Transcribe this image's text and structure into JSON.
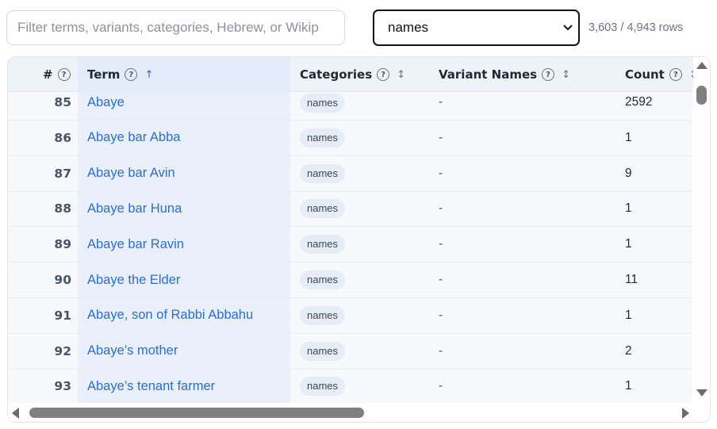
{
  "search": {
    "placeholder": "Filter terms, variants, categories, Hebrew, or Wikip",
    "value": ""
  },
  "category_filter": {
    "selected": "names"
  },
  "row_count": "3,603 / 4,943 rows",
  "columns": {
    "index": "#",
    "term": "Term",
    "categories": "Categories",
    "variant_names": "Variant Names",
    "count": "Count",
    "help_glyph": "?",
    "term_sort": "↑",
    "unsorted_glyph": "↕"
  },
  "rows": [
    {
      "index": "85",
      "term": "Abaye",
      "category": "names",
      "variant": "-",
      "count": "2592"
    },
    {
      "index": "86",
      "term": "Abaye bar Abba",
      "category": "names",
      "variant": "-",
      "count": "1"
    },
    {
      "index": "87",
      "term": "Abaye bar Avin",
      "category": "names",
      "variant": "-",
      "count": "9"
    },
    {
      "index": "88",
      "term": "Abaye bar Huna",
      "category": "names",
      "variant": "-",
      "count": "1"
    },
    {
      "index": "89",
      "term": "Abaye bar Ravin",
      "category": "names",
      "variant": "-",
      "count": "1"
    },
    {
      "index": "90",
      "term": "Abaye the Elder",
      "category": "names",
      "variant": "-",
      "count": "11"
    },
    {
      "index": "91",
      "term": "Abaye, son of Rabbi Abbahu",
      "category": "names",
      "variant": "-",
      "count": "1"
    },
    {
      "index": "92",
      "term": "Abaye’s mother",
      "category": "names",
      "variant": "-",
      "count": "2"
    },
    {
      "index": "93",
      "term": "Abaye’s tenant farmer",
      "category": "names",
      "variant": "-",
      "count": "1"
    }
  ],
  "colors": {
    "link": "#2a6ed1",
    "header_bg": "#eef3fa",
    "active_sort_bg": "#e3ecfa"
  }
}
